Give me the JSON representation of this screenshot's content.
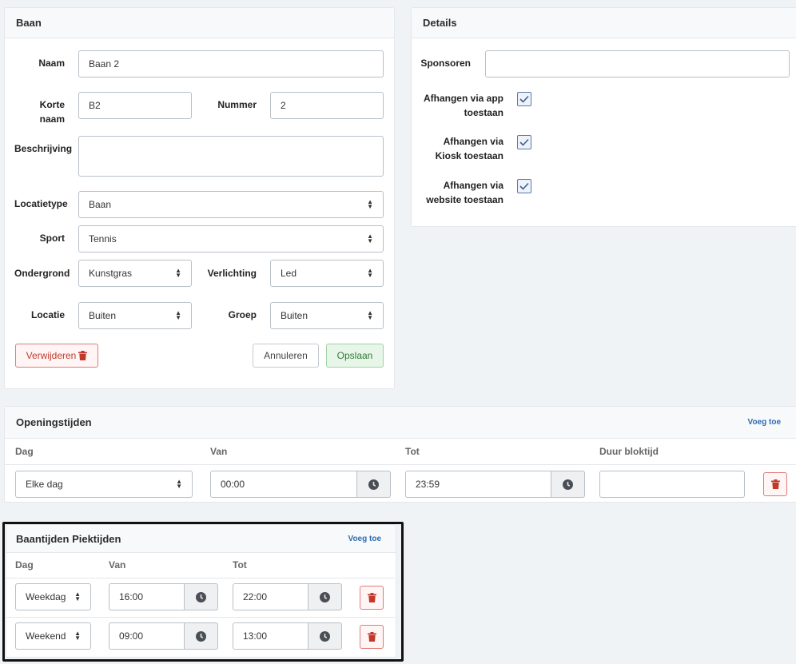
{
  "baan_card": {
    "title": "Baan",
    "naam_label": "Naam",
    "naam_value": "Baan 2",
    "korte_naam_label_1": "Korte",
    "korte_naam_label_2": "naam",
    "korte_naam_value": "B2",
    "nummer_label": "Nummer",
    "nummer_value": "2",
    "beschrijving_label": "Beschrijving",
    "beschrijving_value": "",
    "locatietype_label": "Locatietype",
    "locatietype_value": "Baan",
    "sport_label": "Sport",
    "sport_value": "Tennis",
    "ondergrond_label": "Ondergrond",
    "ondergrond_value": "Kunstgras",
    "verlichting_label": "Verlichting",
    "verlichting_value": "Led",
    "locatie_label": "Locatie",
    "locatie_value": "Buiten",
    "groep_label": "Groep",
    "groep_value": "Buiten",
    "delete_label": "Verwijderen",
    "cancel_label": "Annuleren",
    "save_label": "Opslaan"
  },
  "details_card": {
    "title": "Details",
    "sponsoren_label": "Sponsoren",
    "sponsoren_value": "",
    "app_label_1": "Afhangen via app",
    "app_label_2": "toestaan",
    "kiosk_label_1": "Afhangen via",
    "kiosk_label_2": "Kiosk toestaan",
    "website_label_1": "Afhangen via",
    "website_label_2": "website toestaan",
    "app_checked": true,
    "kiosk_checked": true,
    "website_checked": true
  },
  "openingstijden": {
    "title": "Openingstijden",
    "add_label": "Voeg toe",
    "col_dag": "Dag",
    "col_van": "Van",
    "col_tot": "Tot",
    "col_duur": "Duur bloktijd",
    "rows": [
      {
        "dag": "Elke dag",
        "van": "00:00",
        "tot": "23:59",
        "duur": ""
      }
    ]
  },
  "piektijden": {
    "title": "Baantijden Piektijden",
    "add_label": "Voeg toe",
    "col_dag": "Dag",
    "col_van": "Van",
    "col_tot": "Tot",
    "rows": [
      {
        "dag": "Weekdag",
        "van": "16:00",
        "tot": "22:00"
      },
      {
        "dag": "Weekend",
        "van": "09:00",
        "tot": "13:00"
      }
    ]
  },
  "icons": {
    "trash": "trash-icon",
    "clock": "clock-icon",
    "check": "check-icon",
    "select_caret": "select-caret-icon"
  },
  "colors": {
    "danger": "#c0392b",
    "success": "#2e7d32",
    "link": "#2d6bb3"
  }
}
